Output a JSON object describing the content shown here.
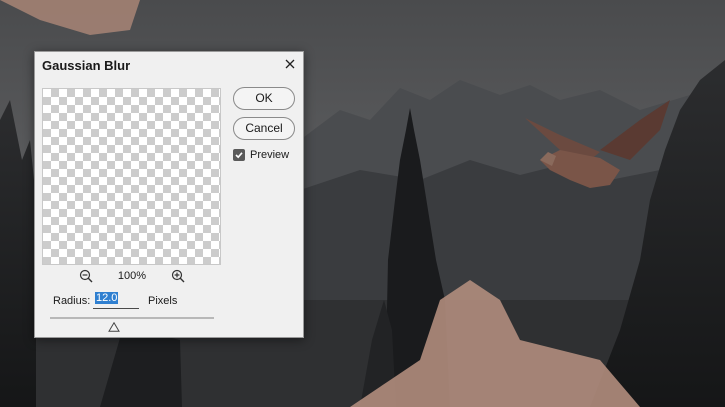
{
  "dialog": {
    "title": "Gaussian Blur",
    "ok_label": "OK",
    "cancel_label": "Cancel",
    "preview_label": "Preview",
    "preview_checked": true,
    "zoom_level": "100%",
    "radius_label": "Radius:",
    "radius_value": "12.0",
    "radius_unit": "Pixels",
    "slider_level_fraction": 0.39
  },
  "icons": {
    "close": "close-icon",
    "zoom_out": "zoom-out-icon",
    "zoom_in": "zoom-in-icon",
    "checkbox": "checkmark-icon"
  },
  "colors": {
    "selection": "#2f7fd0",
    "dialog_bg": "#f0f0f0"
  }
}
